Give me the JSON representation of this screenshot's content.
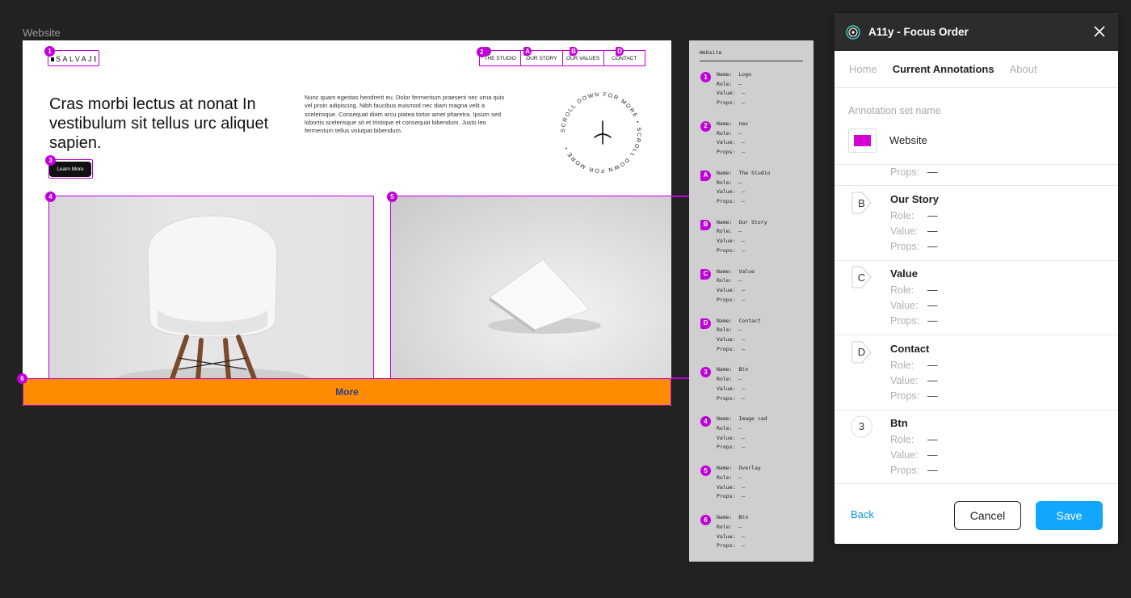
{
  "frame": {
    "label": "Website",
    "logo_text": "SALVAJE",
    "nav": [
      "THE STUDIO",
      "OUR STORY",
      "OUR VALUES",
      "CONTACT"
    ],
    "headline": "Cras morbi lectus at nonat In vestibulum sit tellus urc aliquet sapien.",
    "paragraph": "Nunc quam egestas hendrerit eu. Dolor fermentum praesent nec urna quis vel proin adipiscing. Nibh faucibus euismod nec diam magna velit a scelerisque. Consequat diam arcu platea tortor amet pharetra. Ipsum sed lobortis scelerisque sit et tristique et consequat bibendum. Justo leo fermentum tellus volutpat bibendum.",
    "circle_text": "SCROLL DOWN FOR MORE • SCROLL DOWN FOR MORE •",
    "learn_more": "Learn More",
    "more": "More",
    "markers": [
      "1",
      "2",
      "A",
      "B",
      "C",
      "D",
      "3",
      "4",
      "5",
      "6"
    ],
    "annotation_color": "#c000d9",
    "more_bar_color": "#ff8c00"
  },
  "sidebar": {
    "title": "Website",
    "items": [
      {
        "marker": "1",
        "name": "Name:  Logo",
        "role": "Role:  –",
        "value": "Value:  –",
        "props": "Props:  –"
      },
      {
        "marker": "2",
        "name": "Name:  nav",
        "role": "Role:  –",
        "value": "Value:  –",
        "props": "Props:  –"
      },
      {
        "marker": "A",
        "name": "Name:  The Studio",
        "role": "Role:  –",
        "value": "Value:  –",
        "props": "Props:  –"
      },
      {
        "marker": "B",
        "name": "Name:  Our Story",
        "role": "Role:  –",
        "value": "Value:  –",
        "props": "Props:  –"
      },
      {
        "marker": "C",
        "name": "Name:  Value",
        "role": "Role:  –",
        "value": "Value:  –",
        "props": "Props:  –"
      },
      {
        "marker": "D",
        "name": "Name:  Contact",
        "role": "Role:  –",
        "value": "Value:  –",
        "props": "Props:  –"
      },
      {
        "marker": "3",
        "name": "Name:  Btn",
        "role": "Role:  –",
        "value": "Value:  –",
        "props": "Props:  –"
      },
      {
        "marker": "4",
        "name": "Name:  Image cad",
        "role": "Role:  –",
        "value": "Value:  –",
        "props": "Props:  –"
      },
      {
        "marker": "5",
        "name": "Name:  Overlay",
        "role": "Role:  –",
        "value": "Value:  –",
        "props": "Props:  –"
      },
      {
        "marker": "6",
        "name": "Name:  Btn",
        "role": "Role:  –",
        "value": "Value:  –",
        "props": "Props:  –"
      }
    ]
  },
  "panel": {
    "title": "A11y - Focus Order",
    "tabs": [
      "Home",
      "Current Annotations",
      "About"
    ],
    "active_tab": "Current Annotations",
    "set_name_label": "Annotation set name",
    "set_name_value": "Website",
    "swatch_color": "#d400d6",
    "labels": {
      "role": "Role:",
      "value": "Value:",
      "props": "Props:"
    },
    "partial_props": "Props:",
    "dash": "—",
    "cards": [
      {
        "badge": "B",
        "name": "Our Story",
        "role": "—",
        "value": "—",
        "props": "—"
      },
      {
        "badge": "C",
        "name": "Value",
        "role": "—",
        "value": "—",
        "props": "—"
      },
      {
        "badge": "D",
        "name": "Contact",
        "role": "—",
        "value": "—",
        "props": "—"
      },
      {
        "badge": "3",
        "name": "Btn",
        "role": "—",
        "value": "—",
        "props": "—"
      }
    ],
    "back": "Back",
    "cancel": "Cancel",
    "save": "Save",
    "link_color": "#0a98e0",
    "save_color": "#12a6ff"
  }
}
